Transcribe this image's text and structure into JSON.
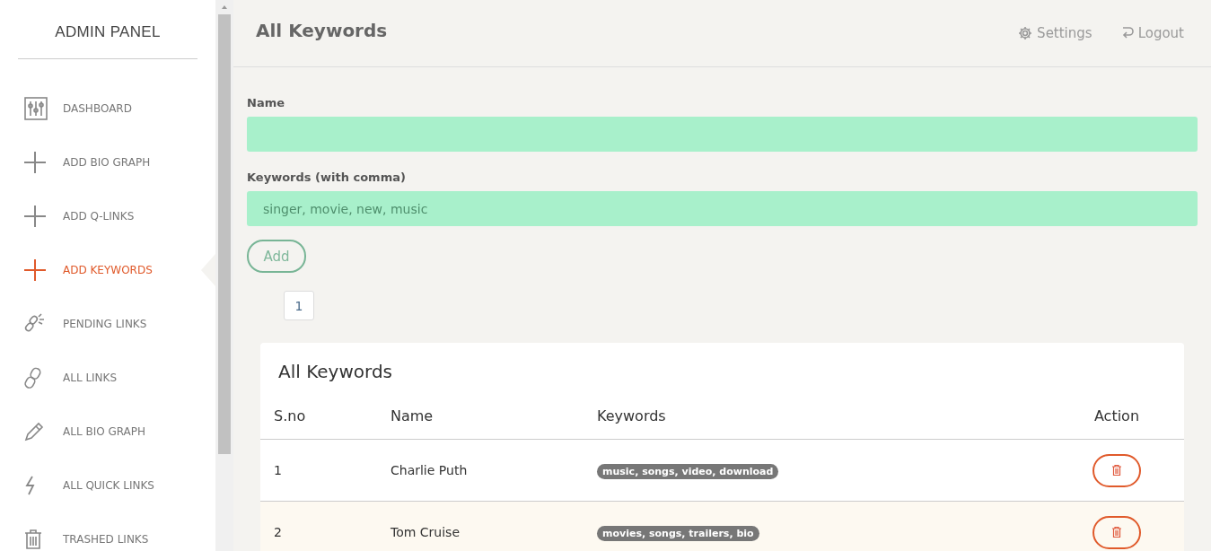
{
  "sidebar": {
    "title": "ADMIN PANEL",
    "items": [
      {
        "label": "DASHBOARD",
        "kind": "sliders",
        "selected": false
      },
      {
        "label": "ADD BIO GRAPH",
        "kind": "plus",
        "selected": false
      },
      {
        "label": "ADD Q-LINKS",
        "kind": "plus",
        "selected": false
      },
      {
        "label": "ADD KEYWORDS",
        "kind": "plus",
        "selected": true
      },
      {
        "label": "PENDING LINKS",
        "kind": "broken-link",
        "selected": false
      },
      {
        "label": "ALL LINKS",
        "kind": "link",
        "selected": false
      },
      {
        "label": "ALL BIO GRAPH",
        "kind": "pencil",
        "selected": false
      },
      {
        "label": "ALL QUICK LINKS",
        "kind": "bolt",
        "selected": false
      },
      {
        "label": "TRASHED LINKS",
        "kind": "trash",
        "selected": false
      }
    ]
  },
  "header": {
    "title": "All Keywords",
    "actions": [
      {
        "label": "Settings",
        "kind": "gear"
      },
      {
        "label": "Logout",
        "kind": "logout"
      }
    ]
  },
  "form": {
    "fields": [
      {
        "label": "Name"
      },
      {
        "label": "Keywords (with comma)",
        "placeholder": "singer, movie, new, music"
      }
    ],
    "submit": "Add"
  },
  "pagination": [
    {
      "label": "1",
      "selected": true
    }
  ],
  "table": {
    "title": "All Keywords",
    "columns": [
      "S.no",
      "Name",
      "Keywords",
      "Action"
    ],
    "rows": [
      {
        "sno": "1",
        "name": "Charlie Puth",
        "keywords": "music, songs, video, download",
        "highlighted": false
      },
      {
        "sno": "2",
        "name": "Tom Cruise",
        "keywords": "movies, songs, trailers, bio",
        "highlighted": true
      }
    ]
  }
}
